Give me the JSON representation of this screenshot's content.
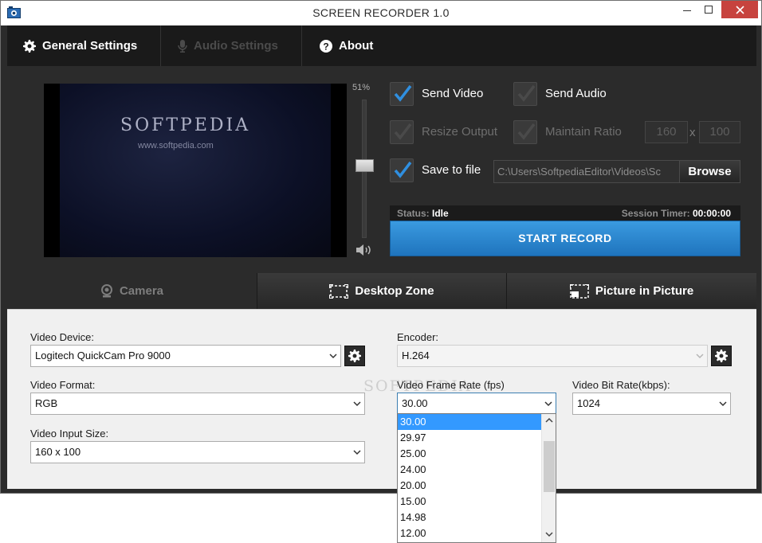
{
  "window": {
    "title": "SCREEN RECORDER 1.0"
  },
  "nav": {
    "general": "General Settings",
    "audio": "Audio Settings",
    "about": "About"
  },
  "preview": {
    "logo": "SOFTPEDIA",
    "url": "www.softpedia.com"
  },
  "volume": {
    "label": "51%",
    "level": 0.51
  },
  "options": {
    "send_video": "Send Video",
    "send_audio": "Send Audio",
    "resize_output": "Resize Output",
    "maintain_ratio": "Maintain Ratio",
    "width": "160",
    "height": "100",
    "times": "x",
    "save_to_file": "Save to file",
    "file_path": "C:\\Users\\SoftpediaEditor\\Videos\\Sc",
    "browse": "Browse"
  },
  "status": {
    "status_label": "Status:",
    "status_value": "Idle",
    "timer_label": "Session Timer:",
    "timer_value": "00:00:00"
  },
  "record_button": "START RECORD",
  "source_tabs": {
    "camera": "Camera",
    "desktop": "Desktop Zone",
    "pip": "Picture in Picture"
  },
  "settings": {
    "video_device_label": "Video Device:",
    "video_device": "Logitech QuickCam Pro 9000",
    "encoder_label": "Encoder:",
    "encoder": "H.264",
    "video_format_label": "Video Format:",
    "video_format": "RGB",
    "frame_rate_label": "Video Frame Rate (fps)",
    "frame_rate": "30.00",
    "bit_rate_label": "Video Bit Rate(kbps):",
    "bit_rate": "1024",
    "input_size_label": "Video Input Size:",
    "input_size": "160 x 100"
  },
  "frame_rate_options": [
    "30.00",
    "29.97",
    "25.00",
    "24.00",
    "20.00",
    "15.00",
    "14.98",
    "12.00"
  ],
  "watermark": "SOFTPEDIA",
  "colors": {
    "accent": "#2b86d0",
    "selection": "#3399ff",
    "dark_bg": "#2b2b2b",
    "close": "#c7433e"
  }
}
